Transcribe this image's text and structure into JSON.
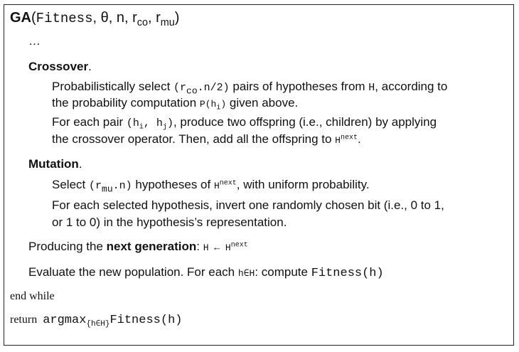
{
  "title": {
    "name": "GA",
    "open": "(",
    "fitness": "Fitness",
    "sep1": ", ",
    "theta": "θ",
    "sep2": ", ",
    "n": "n",
    "sep3": ", ",
    "r": "r",
    "co": "co",
    "sep4": ", ",
    "r2": "r",
    "mu": "mu",
    "close": ")"
  },
  "ellipsis": "…",
  "crossover": {
    "heading": "Crossover",
    "dot": ".",
    "l1_a": "Probabilistically select ",
    "l1_open": "(",
    "l1_r": "r",
    "l1_co": "co",
    "l1_rest": ".n/2",
    "l1_close": ")",
    "l1_b": " pairs of hypotheses from ",
    "l1_H": "H",
    "l1_c": ", according to",
    "l2_a": "the probability computation ",
    "l2_P": "P(h",
    "l2_i": "i",
    "l2_Pc": ")",
    "l2_b": " given above.",
    "l3_a": "For each pair ",
    "l3_open": "(h",
    "l3_i": "i",
    "l3_comma": ", h",
    "l3_j": "j",
    "l3_close": ")",
    "l3_b": ", produce two offspring (i.e., children) by applying",
    "l4_a": "the crossover operator. Then, add all the offspring to ",
    "l4_H": "H",
    "l4_next": "next",
    "l4_b": "."
  },
  "mutation": {
    "heading": "Mutation",
    "dot": ".",
    "l1_a": "Select ",
    "l1_open": "(",
    "l1_r": "r",
    "l1_mu": "mu",
    "l1_rest": ".n",
    "l1_close": ")",
    "l1_b": " hypotheses of ",
    "l1_H": "H",
    "l1_next": "next",
    "l1_c": ", with uniform probability.",
    "l2": "For each selected hypothesis, invert one randomly chosen bit (i.e., 0 to 1,",
    "l3": "or 1 to 0) in the hypothesis’s representation."
  },
  "produce": {
    "a": "Producing the ",
    "bold": "next generation",
    "b": ":  ",
    "H": "H",
    "arrow": " ← ",
    "H2": "H",
    "next": "next"
  },
  "evaluate": {
    "a": "Evaluate the new population. For each ",
    "code": "h∈H",
    "b": ":  compute ",
    "fn": "Fitness(h)"
  },
  "endwhile": "end while",
  "ret": {
    "kw": "return",
    "fn": "argmax",
    "sub": "{h∈H}",
    "arg": "Fitness(h)"
  }
}
